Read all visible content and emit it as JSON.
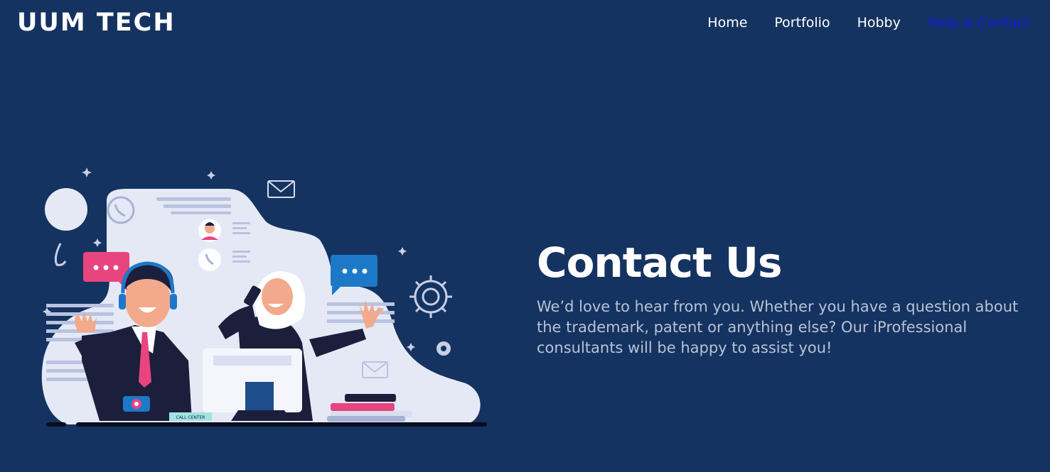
{
  "brand": "UUM TECH",
  "nav": {
    "items": [
      {
        "label": "Home",
        "active": false
      },
      {
        "label": "Portfolio",
        "active": false
      },
      {
        "label": "Hobby",
        "active": false
      },
      {
        "label": "Help & Contact",
        "active": true
      }
    ]
  },
  "hero": {
    "title": "Contact Us",
    "description": "We’d love to hear from you. Whether you have a question about the trademark, patent or anything else? Our iProfessional consultants will be happy to assist you!",
    "illustration_label": "CALL CENTER"
  },
  "colors": {
    "background": "#153360",
    "text": "#ffffff",
    "muted_text": "#b7c3d7",
    "active_link": "#0d1ce0",
    "accent_pink": "#e8457f",
    "accent_blue": "#1e78c8",
    "shape_light": "#e5e9f6"
  }
}
